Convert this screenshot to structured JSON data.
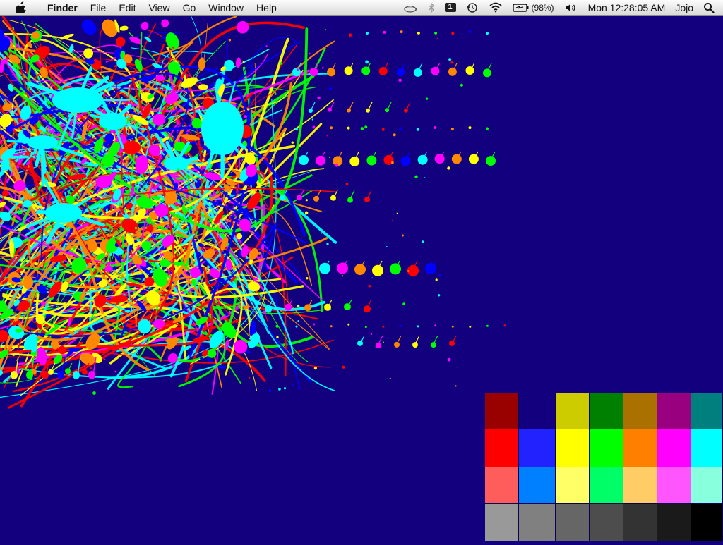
{
  "menubar": {
    "apple_icon": "apple-logo-icon",
    "items": [
      {
        "label": "Finder",
        "bold": true
      },
      {
        "label": "File"
      },
      {
        "label": "Edit"
      },
      {
        "label": "View"
      },
      {
        "label": "Go"
      },
      {
        "label": "Window"
      },
      {
        "label": "Help"
      }
    ],
    "status": {
      "icons": [
        "coffee-cup-icon",
        "bluetooth-icon",
        "spaces-icon",
        "time-machine-icon",
        "wifi-icon",
        "battery-icon",
        "volume-icon",
        "spotlight-icon"
      ],
      "spaces_number": "1",
      "battery_percent": "(98%)",
      "clock": "Mon 12:28:05 AM",
      "user": "Jojo"
    }
  },
  "desktop": {
    "background_color": "#12007f",
    "splatter_colors": [
      "#00ffff",
      "#ff00ff",
      "#ff8800",
      "#ffff00",
      "#00ff00",
      "#ff0000",
      "#0000ff"
    ]
  },
  "palette": {
    "rows": [
      [
        "#990000",
        "#12007f",
        "#cccc00",
        "#008000",
        "#aa7000",
        "#990080",
        "#007f7f"
      ],
      [
        "#ff0000",
        "#2222ff",
        "#ffff00",
        "#00ff00",
        "#ff8000",
        "#ff00ff",
        "#00ffff"
      ],
      [
        "#ff5c5c",
        "#0080ff",
        "#ffff66",
        "#00ff66",
        "#ffcc66",
        "#ff55ff",
        "#88ffdd"
      ],
      [
        "#999999",
        "#808080",
        "#666666",
        "#4d4d4d",
        "#333333",
        "#1a1a1a",
        "#000000"
      ]
    ]
  }
}
